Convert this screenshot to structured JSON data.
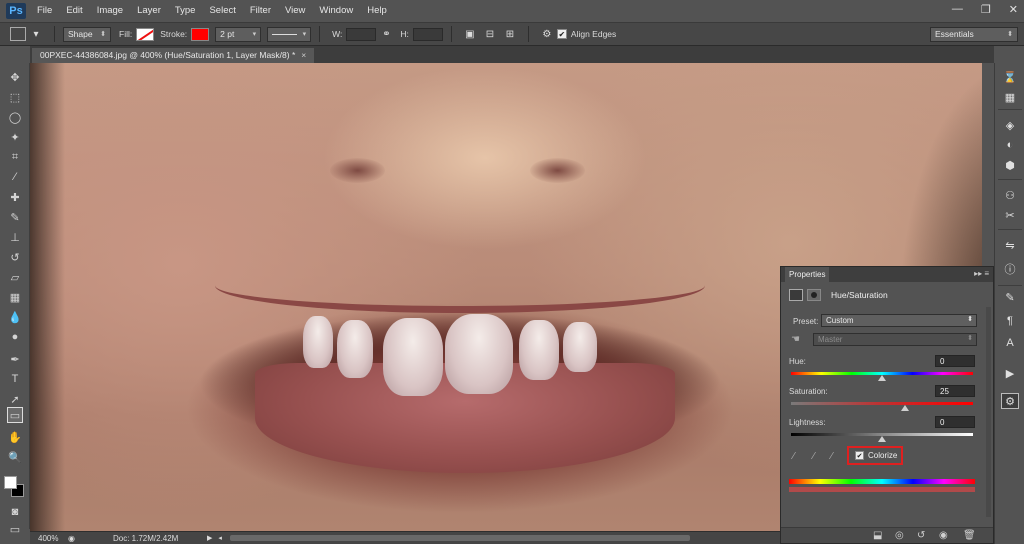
{
  "app": {
    "logo": "Ps"
  },
  "menu": [
    "File",
    "Edit",
    "Image",
    "Layer",
    "Type",
    "Select",
    "Filter",
    "View",
    "Window",
    "Help"
  ],
  "window_controls": {
    "minimize": "—",
    "restore": "❐",
    "close": "✕"
  },
  "options": {
    "shape_mode": "Shape",
    "fill_label": "Fill:",
    "stroke_label": "Stroke:",
    "stroke_width": "2 pt",
    "w_label": "W:",
    "h_label": "H:",
    "align_edges": "Align Edges",
    "workspace": "Essentials",
    "stroke_color": "#ff0000"
  },
  "document": {
    "tab_title": "00PXEC-44386084.jpg @ 400% (Hue/Saturation 1, Layer Mask/8) *",
    "zoom": "400%",
    "doc_size": "Doc: 1.72M/2.42M"
  },
  "properties": {
    "panel_tab": "Properties",
    "adjustment": "Hue/Saturation",
    "preset_label": "Preset:",
    "preset_value": "Custom",
    "channel": "Master",
    "hue_label": "Hue:",
    "hue_value": "0",
    "saturation_label": "Saturation:",
    "saturation_value": "25",
    "lightness_label": "Lightness:",
    "lightness_value": "0",
    "colorize_label": "Colorize",
    "colorize_checked": true
  }
}
